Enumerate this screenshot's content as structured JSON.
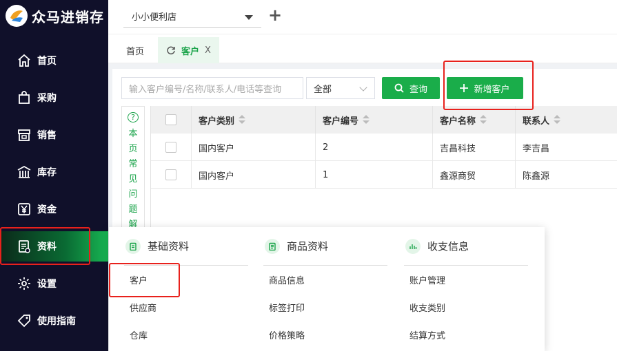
{
  "app": {
    "name": "众马进销存"
  },
  "topbar": {
    "store_name": "小小便利店",
    "add_label": "+"
  },
  "tabs": [
    {
      "label": "首页"
    },
    {
      "label": "客户",
      "close": "X"
    }
  ],
  "nav": [
    {
      "label": "首页",
      "icon": "home-icon"
    },
    {
      "label": "采购",
      "icon": "bag-icon"
    },
    {
      "label": "销售",
      "icon": "store-icon"
    },
    {
      "label": "库存",
      "icon": "warehouse-icon"
    },
    {
      "label": "资金",
      "icon": "yen-icon"
    },
    {
      "label": "资料",
      "icon": "document-icon",
      "active": true
    },
    {
      "label": "设置",
      "icon": "gear-icon"
    },
    {
      "label": "使用指南",
      "icon": "tag-icon"
    }
  ],
  "search": {
    "placeholder": "输入客户编号/名称/联系人/电话等查询",
    "filter_value": "全部",
    "query_label": "查询",
    "add_label": "新增客户"
  },
  "faq": {
    "chars": [
      "本",
      "页",
      "常",
      "见",
      "问",
      "题",
      "解"
    ]
  },
  "table": {
    "columns": [
      "客户类别",
      "客户编号",
      "客户名称",
      "联系人"
    ],
    "rows": [
      [
        "国内客户",
        "2",
        "吉昌科技",
        "李吉昌"
      ],
      [
        "国内客户",
        "1",
        "鑫源商贸",
        "陈鑫源"
      ]
    ]
  },
  "menu": {
    "sections": [
      {
        "title": "基础资料",
        "items": [
          "客户",
          "供应商",
          "仓库"
        ]
      },
      {
        "title": "商品资料",
        "items": [
          "商品信息",
          "标签打印",
          "价格策略"
        ]
      },
      {
        "title": "收支信息",
        "items": [
          "账户管理",
          "收支类别",
          "结算方式"
        ]
      }
    ]
  },
  "colors": {
    "accent": "#1aad4a",
    "sidebar": "#10102a",
    "highlight": "#e8211c"
  }
}
